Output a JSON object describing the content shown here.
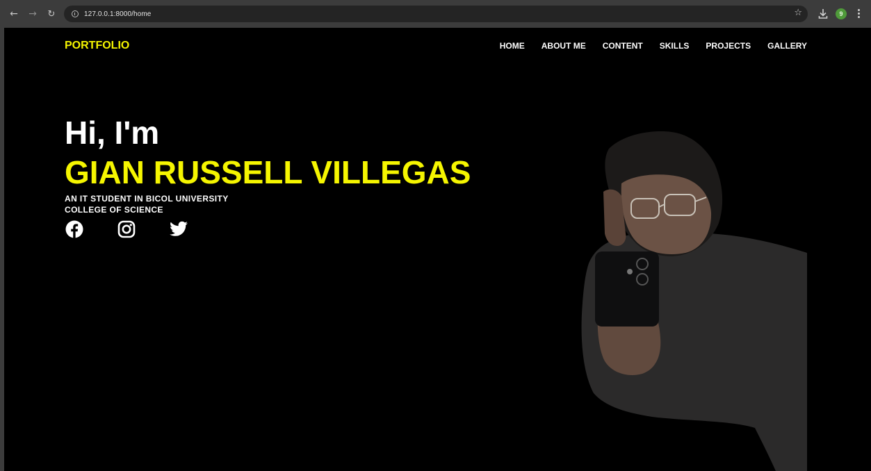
{
  "browser": {
    "url": "127.0.0.1:8000/home",
    "profile_badge": "9",
    "icons": [
      "back-arrow-icon",
      "forward-arrow-icon",
      "reload-icon",
      "info-icon",
      "star-icon",
      "download-icon",
      "kebab-menu-icon"
    ]
  },
  "site": {
    "brand": "PORTFOLIO",
    "nav": [
      "HOME",
      "ABOUT ME",
      "CONTENT",
      "SKILLS",
      "PROJECTS",
      "GALLERY"
    ]
  },
  "hero": {
    "greeting": "Hi, I'm",
    "name": "GIAN RUSSELL VILLEGAS",
    "tagline_line1": "AN IT STUDENT IN BICOL UNIVERSITY",
    "tagline_line2": "COLLEGE OF SCIENCE",
    "socials": [
      "facebook-icon",
      "instagram-icon",
      "twitter-icon"
    ]
  },
  "colors": {
    "accent": "#f5f500",
    "background": "#000000",
    "chrome": "#3c3c3c"
  }
}
